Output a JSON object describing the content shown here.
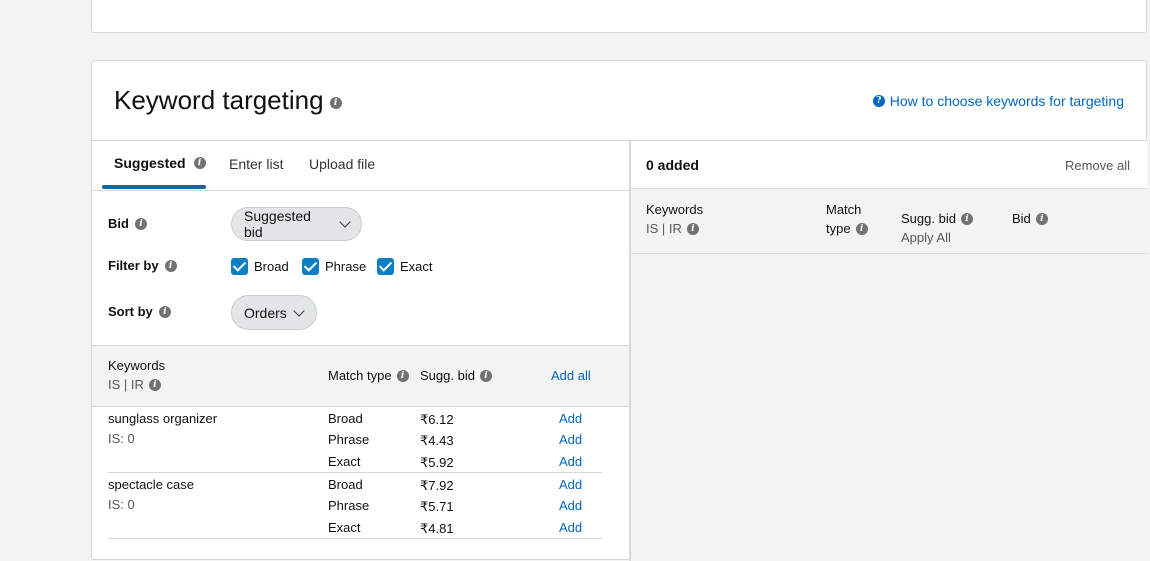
{
  "top_card": {},
  "section": {
    "title": "Keyword targeting",
    "help_link": "How to choose keywords for targeting"
  },
  "tabs": [
    {
      "label": "Suggested",
      "active": true
    },
    {
      "label": "Enter list",
      "active": false
    },
    {
      "label": "Upload file",
      "active": false
    }
  ],
  "filters": {
    "bid_label": "Bid",
    "bid_value": "Suggested bid",
    "filter_label": "Filter by",
    "filter_options": [
      {
        "label": "Broad",
        "checked": true
      },
      {
        "label": "Phrase",
        "checked": true
      },
      {
        "label": "Exact",
        "checked": true
      }
    ],
    "sort_label": "Sort by",
    "sort_value": "Orders"
  },
  "left_table": {
    "col_keywords": "Keywords",
    "col_keywords_sub": "IS | IR",
    "col_match_type": "Match type",
    "col_sugg_bid": "Sugg. bid",
    "add_all": "Add all",
    "add_label": "Add",
    "rows": [
      {
        "keyword": "sunglass organizer",
        "is": "IS: 0",
        "entries": [
          {
            "match": "Broad",
            "bid": "₹6.12"
          },
          {
            "match": "Phrase",
            "bid": "₹4.43"
          },
          {
            "match": "Exact",
            "bid": "₹5.92"
          }
        ]
      },
      {
        "keyword": "spectacle case",
        "is": "IS: 0",
        "entries": [
          {
            "match": "Broad",
            "bid": "₹7.92"
          },
          {
            "match": "Phrase",
            "bid": "₹5.71"
          },
          {
            "match": "Exact",
            "bid": "₹4.81"
          }
        ]
      }
    ]
  },
  "right_panel": {
    "added_count": "0 added",
    "remove_all": "Remove all",
    "col_keywords": "Keywords",
    "col_keywords_sub": "IS | IR",
    "col_match_type_line1": "Match",
    "col_match_type_line2": "type",
    "col_sugg_bid": "Sugg. bid",
    "apply_all": "Apply All",
    "col_bid": "Bid"
  }
}
